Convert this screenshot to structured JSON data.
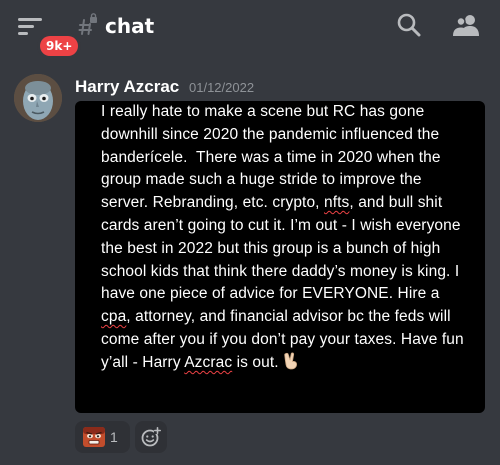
{
  "header": {
    "badge": "9k+",
    "channel_name": "chat"
  },
  "message": {
    "author": "Harry Azcrac",
    "timestamp": "01/12/2022",
    "text_plain_1": "I really hate to make a scene but RC has gone downhill since 2020 the pandemic influenced the banderícele.  There was a time in 2020 when the group made such a huge stride to improve the server. Rebranding, etc. crypto, ",
    "text_flag_1": "nfts",
    "text_plain_2": ", and bull shit cards aren’t going to cut it. I’m out - I wish everyone the best in 2022 but this group is a bunch of high school kids that think there daddy’s money is king. I have one piece of advice for EVERYONE. Hire a ",
    "text_flag_2": "cpa",
    "text_plain_3": ", attorney, and financial advisor bc the feds will come after you if you don’t pay your taxes. Have fun y’all - Harry ",
    "text_flag_3": "Azcrac",
    "text_plain_4": " is out. ",
    "peace_emoji": "victory-hand"
  },
  "reactions": [
    {
      "emoji": "angry-face",
      "count": "1"
    }
  ],
  "colors": {
    "background": "#36393f",
    "message_box": "#000000",
    "badge": "#ed4245",
    "timestamp": "#8e9297",
    "reaction_bg": "#2f3136"
  }
}
